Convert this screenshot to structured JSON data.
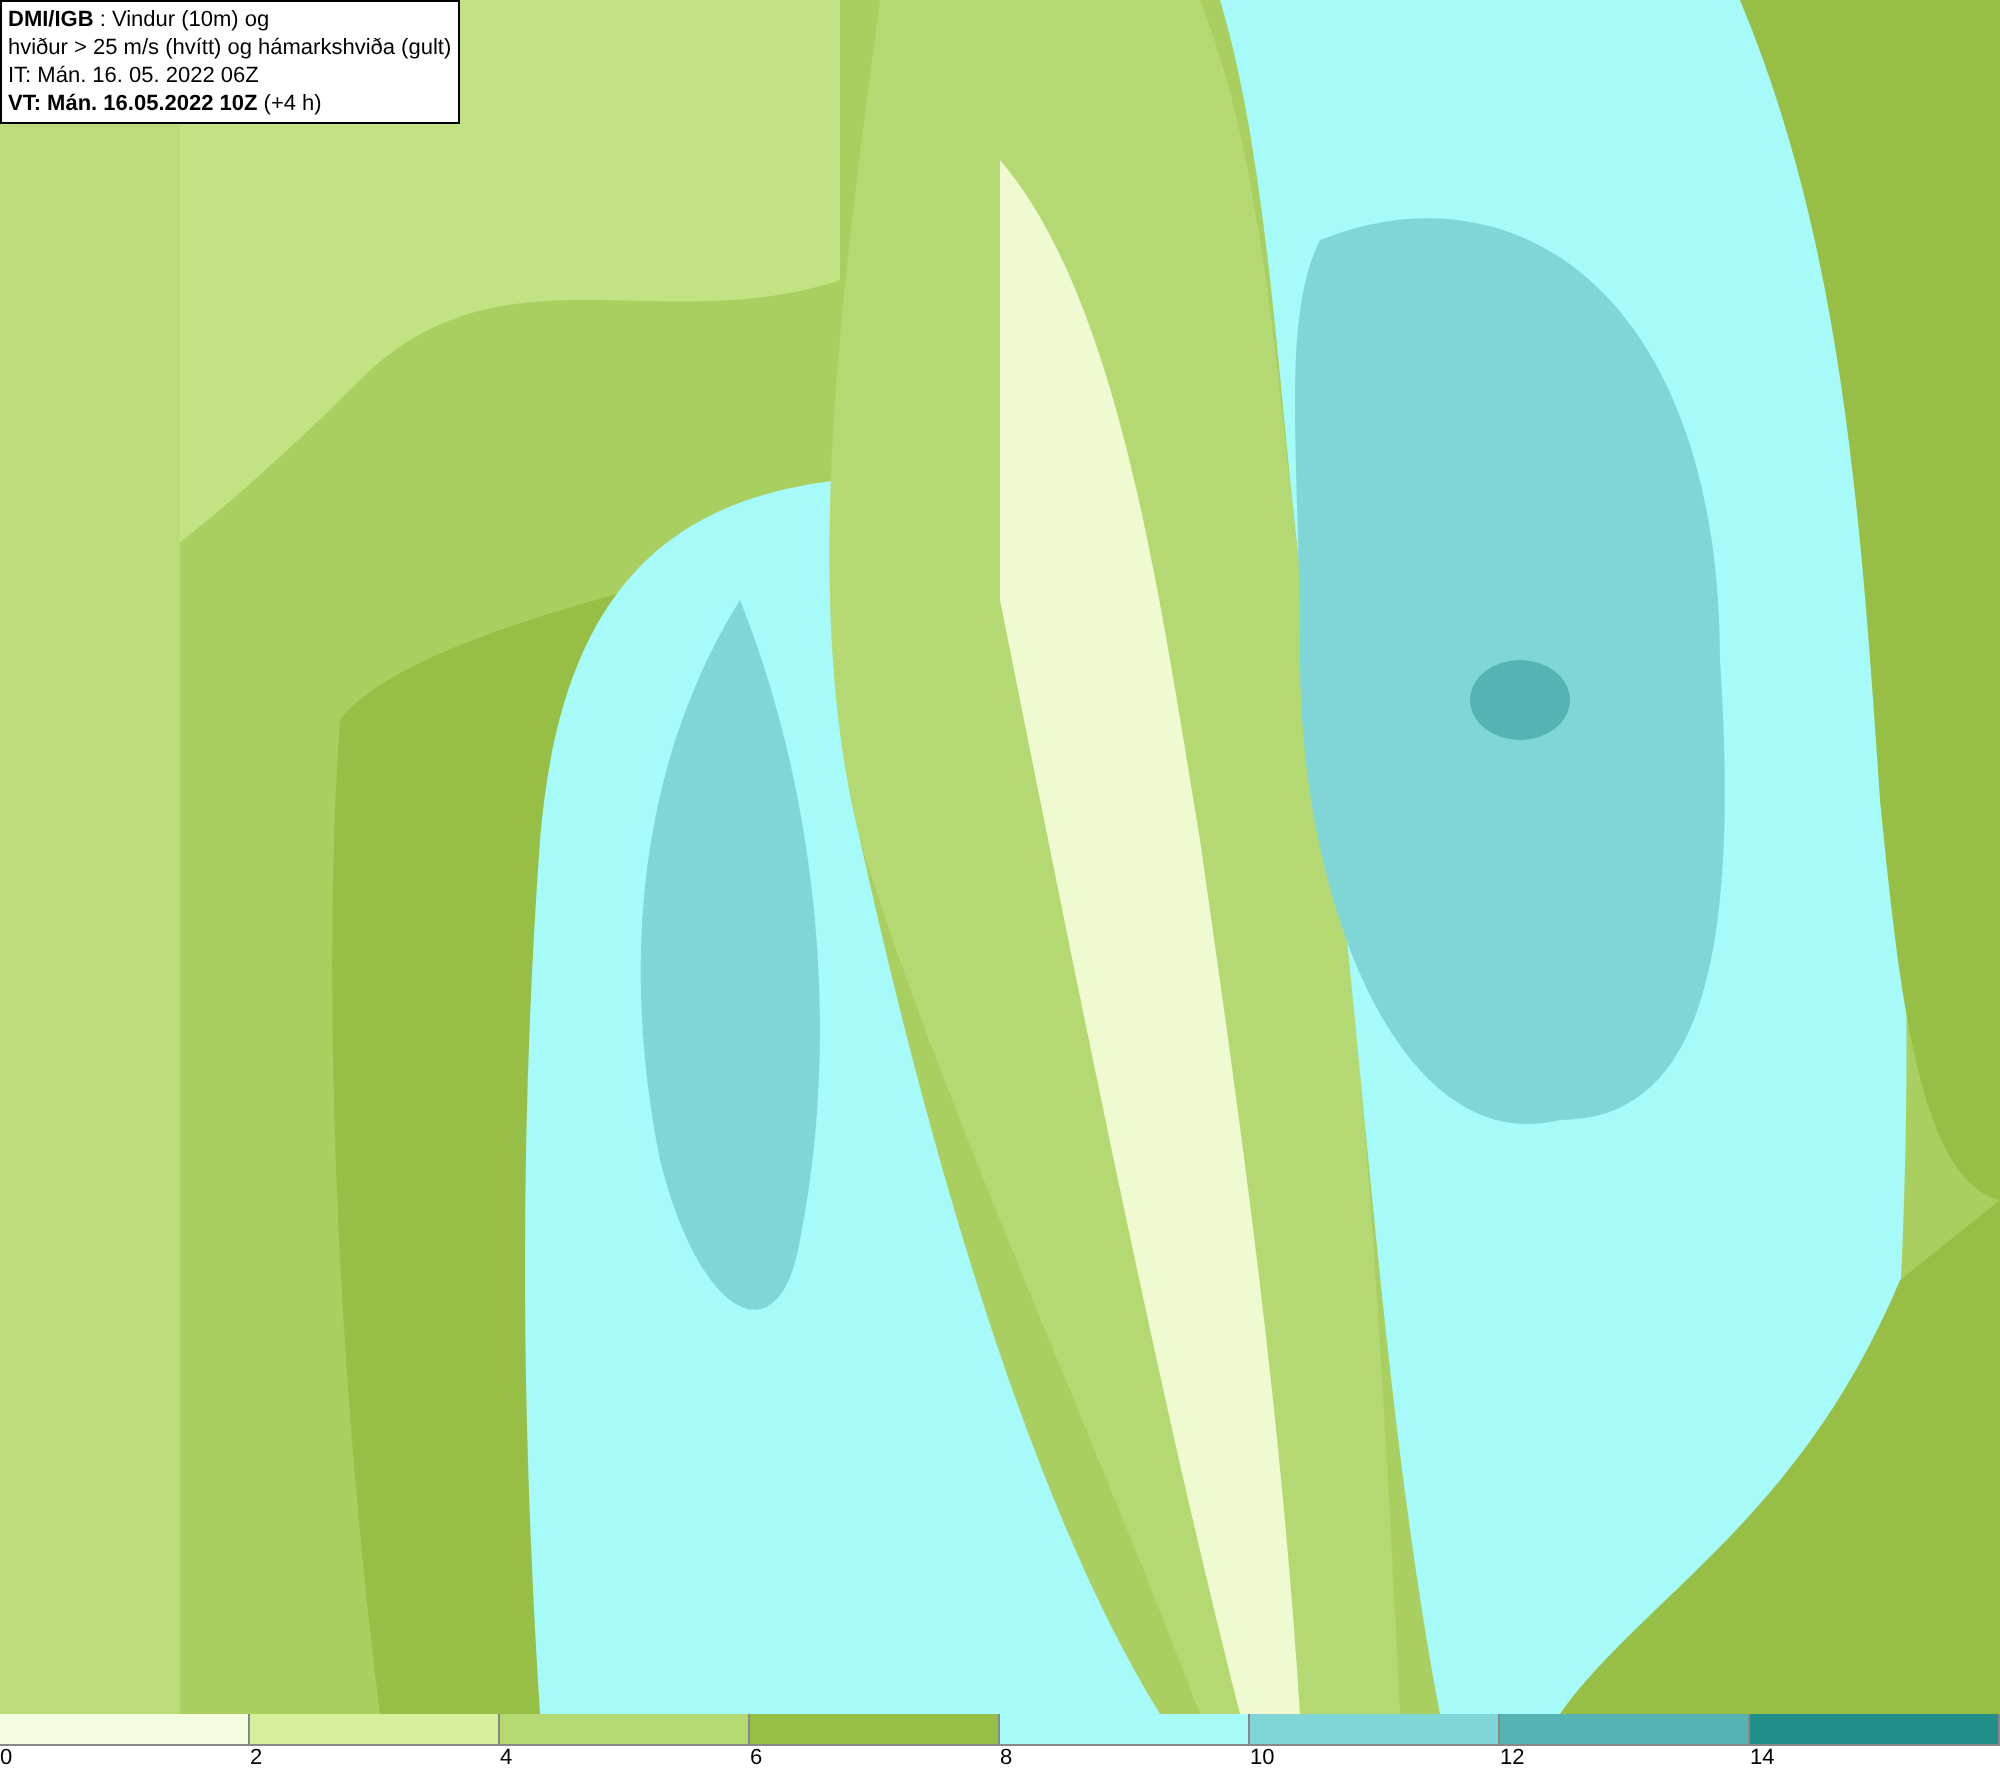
{
  "header": {
    "lines": [
      "**DMI/IGB** : Vindur (10m) og",
      "hviður > 25 m/s (hvítt) og hámarkshviða (gult)",
      "IT: Mán. 16. 05. 2022 06Z",
      "**VT: Mán. 16.05.2022 10Z** (+4 h)"
    ]
  },
  "legend": [
    {
      "label": "0",
      "color": "#f5fde0"
    },
    {
      "label": "2",
      "color": "#d5ef9b"
    },
    {
      "label": "4",
      "color": "#b4d972"
    },
    {
      "label": "6",
      "color": "#97bf45"
    },
    {
      "label": "8",
      "color": "#a6fafa"
    },
    {
      "label": "10",
      "color": "#80d6d6"
    },
    {
      "label": "12",
      "color": "#55b3b3"
    },
    {
      "label": "14",
      "color": "#228e8a"
    }
  ]
}
